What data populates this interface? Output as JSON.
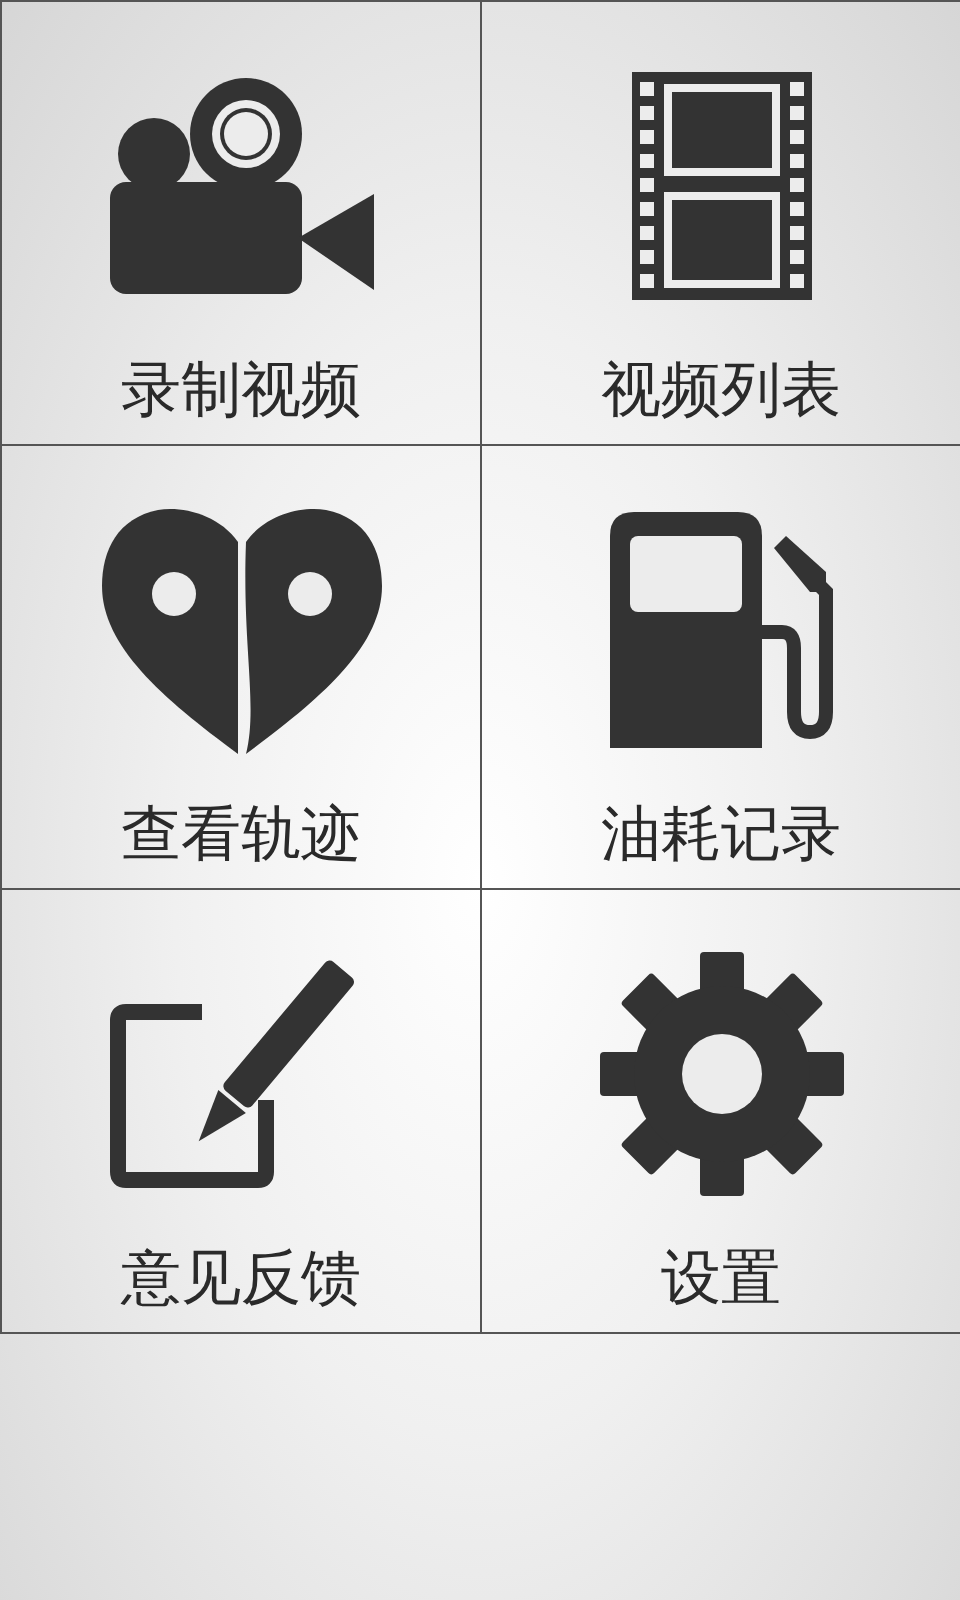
{
  "tiles": [
    {
      "label": "录制视频",
      "kind": "camera"
    },
    {
      "label": "视频列表",
      "kind": "film"
    },
    {
      "label": "查看轨迹",
      "kind": "heart"
    },
    {
      "label": "油耗记录",
      "kind": "fuel"
    },
    {
      "label": "意见反馈",
      "kind": "feedback"
    },
    {
      "label": "设置",
      "kind": "settings"
    }
  ]
}
